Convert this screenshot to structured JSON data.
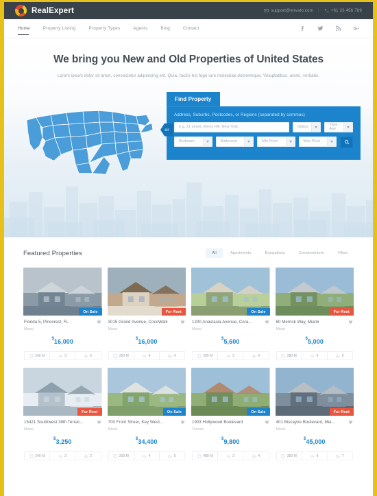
{
  "topbar": {
    "brand_name": "RealExpert",
    "email": "support@envato.com",
    "separator": "|",
    "phone": "+61 23 456 789",
    "email_icon": "envelope-icon",
    "phone_icon": "phone-icon"
  },
  "nav": {
    "items": [
      {
        "label": "Home",
        "active": true
      },
      {
        "label": "Property Listing",
        "active": false
      },
      {
        "label": "Property Types",
        "active": false
      },
      {
        "label": "Agents",
        "active": false
      },
      {
        "label": "Blog",
        "active": false
      },
      {
        "label": "Contact",
        "active": false
      }
    ],
    "social": [
      "facebook-icon",
      "twitter-icon",
      "rss-icon",
      "google-plus-icon"
    ]
  },
  "hero": {
    "heading": "We bring you New and Old Properties of United States",
    "subheading": "Lorem ipsum dolor sit amet, consectetur adipisicing elit. Quia, facilis hic fuge iure molestiae doloremque. Voluptatibus, animi, veritatis.",
    "or_label": "or",
    "map_alt": "united-states-map"
  },
  "search": {
    "panel_title": "Find Property",
    "field_label": "Address, Suburbs, Postcodes, or Regions (separated by commas)",
    "address_placeholder": "e.g. 21 street, Merry Hill, New York",
    "status_placeholder": "Status",
    "type_placeholder": "Type - Any",
    "bedroom_placeholder": "Bedroom",
    "bathroom_placeholder": "Bathroom",
    "min_price_placeholder": "Min Price",
    "max_price_placeholder": "Max Price",
    "search_icon": "magnifier-icon"
  },
  "featured": {
    "title": "Featured Properties",
    "filters": [
      {
        "label": "All",
        "active": true
      },
      {
        "label": "Apartments",
        "active": false
      },
      {
        "label": "Bungalows",
        "active": false
      },
      {
        "label": "Condominium",
        "active": false
      },
      {
        "label": "Villas",
        "active": false
      }
    ],
    "spec_icons": [
      "area-icon",
      "bed-icon",
      "bath-icon"
    ],
    "favorite_icon": "heart-icon",
    "properties": [
      {
        "title": "Florida 5, Pinecrest, FL",
        "city": "Miami",
        "price": "16,000",
        "currency": "$",
        "badge": "On Sale",
        "badge_type": "sale",
        "area": "240 M",
        "beds": "3",
        "baths": "5",
        "image": "suburban-house-driveway"
      },
      {
        "title": "3015 Grand Avenue, CocoWalk",
        "city": "Miami",
        "price": "16,000",
        "currency": "$",
        "badge": "For Rent",
        "badge_type": "rent",
        "area": "250 M",
        "beds": "4",
        "baths": "4",
        "image": "two-car-garage-house"
      },
      {
        "title": "1200 Anastasia Avenue, Cora...",
        "city": "Miami",
        "price": "5,600",
        "currency": "$",
        "badge": "On Sale",
        "badge_type": "sale",
        "area": "200 M",
        "beds": "3",
        "baths": "4",
        "image": "house-with-lawn"
      },
      {
        "title": "60 Merrick Way, Miami",
        "city": "Miami",
        "price": "5,000",
        "currency": "$",
        "badge": "For Rent",
        "badge_type": "rent",
        "area": "280 M",
        "beds": "4",
        "baths": "6",
        "image": "grey-house-green-yard"
      },
      {
        "title": "15421 Southwest 39th Terrac...",
        "city": "Miami",
        "price": "3,250",
        "currency": "$",
        "badge": "For Rent",
        "badge_type": "rent",
        "area": "240 M",
        "beds": "3",
        "baths": "2",
        "image": "winter-snow-house"
      },
      {
        "title": "700 Front Street, Key West...",
        "city": "Miami",
        "price": "34,400",
        "currency": "$",
        "badge": "On Sale",
        "badge_type": "sale",
        "area": "200 M",
        "beds": "4",
        "baths": "5",
        "image": "white-cottage-lawn"
      },
      {
        "title": "1903 Hollywood Boulevard",
        "city": "Toronto",
        "price": "9,800",
        "currency": "$",
        "badge": "On Sale",
        "badge_type": "sale",
        "area": "480 M",
        "beds": "3",
        "baths": "4",
        "image": "brick-house-garden"
      },
      {
        "title": "401 Biscayne Boulevard, Mia...",
        "city": "Miami",
        "price": "45,000",
        "currency": "$",
        "badge": "For Rent",
        "badge_type": "rent",
        "area": "300 M",
        "beds": "9",
        "baths": "7",
        "image": "estate-house-driveway"
      }
    ]
  },
  "colors": {
    "accent_blue": "#1b84cc",
    "rent_red": "#e9563f",
    "dark_bar": "#3a4249",
    "page_border": "#e8c01a",
    "map_blue": "#4a9dd9"
  }
}
